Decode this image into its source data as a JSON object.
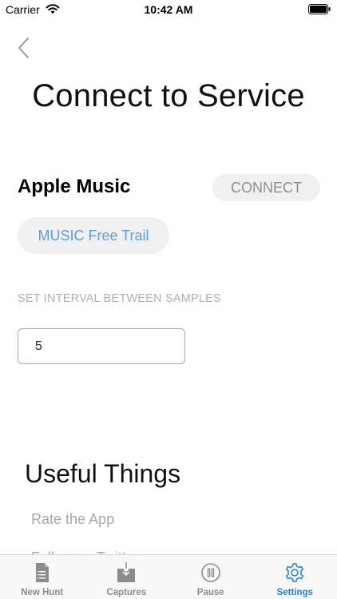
{
  "status_bar": {
    "carrier": "Carrier",
    "time": "10:42 AM"
  },
  "page": {
    "title": "Connect to Service"
  },
  "service": {
    "name": "Apple Music",
    "connect_label": "CONNECT",
    "free_trial_label": "MUSIC Free Trail"
  },
  "interval": {
    "label": "SET INTERVAL BETWEEN SAMPLES",
    "value": "5"
  },
  "useful_things": {
    "title": "Useful Things",
    "items": [
      "Rate the App",
      "Follow on Twitter"
    ]
  },
  "tab_bar": {
    "tabs": [
      {
        "label": "New Hunt",
        "icon": "document-icon"
      },
      {
        "label": "Captures",
        "icon": "download-icon"
      },
      {
        "label": "Pause",
        "icon": "pause-icon"
      },
      {
        "label": "Settings",
        "icon": "gear-icon"
      }
    ],
    "active_tab": "Settings"
  },
  "colors": {
    "accent": "#1f7fd6",
    "link": "#5aa0d8",
    "muted_text": "#a8a8a8",
    "pill_background": "#f0f0f0"
  }
}
